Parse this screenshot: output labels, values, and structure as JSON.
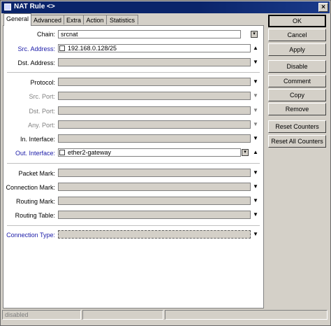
{
  "window": {
    "title": "NAT Rule <>",
    "close": "×"
  },
  "tabs": [
    "General",
    "Advanced",
    "Extra",
    "Action",
    "Statistics"
  ],
  "fields": {
    "chain": {
      "label": "Chain:",
      "value": "srcnat"
    },
    "src_address": {
      "label": "Src. Address:",
      "value": "192.168.0.128/25"
    },
    "dst_address": {
      "label": "Dst. Address:",
      "value": ""
    },
    "protocol": {
      "label": "Protocol:",
      "value": ""
    },
    "src_port": {
      "label": "Src. Port:",
      "value": ""
    },
    "dst_port": {
      "label": "Dst. Port:",
      "value": ""
    },
    "any_port": {
      "label": "Any. Port:",
      "value": ""
    },
    "in_interface": {
      "label": "In. Interface:",
      "value": ""
    },
    "out_interface": {
      "label": "Out. Interface:",
      "value": "ether2-gateway"
    },
    "packet_mark": {
      "label": "Packet Mark:",
      "value": ""
    },
    "connection_mark": {
      "label": "Connection Mark:",
      "value": ""
    },
    "routing_mark": {
      "label": "Routing Mark:",
      "value": ""
    },
    "routing_table": {
      "label": "Routing Table:",
      "value": ""
    },
    "connection_type": {
      "label": "Connection Type:",
      "value": ""
    }
  },
  "buttons": {
    "ok": "OK",
    "cancel": "Cancel",
    "apply": "Apply",
    "disable": "Disable",
    "comment": "Comment",
    "copy": "Copy",
    "remove": "Remove",
    "reset_counters": "Reset Counters",
    "reset_all_counters": "Reset All Counters"
  },
  "glyphs": {
    "down": "▼",
    "up": "▲",
    "dd": "▾"
  },
  "status": {
    "text": "disabled"
  }
}
